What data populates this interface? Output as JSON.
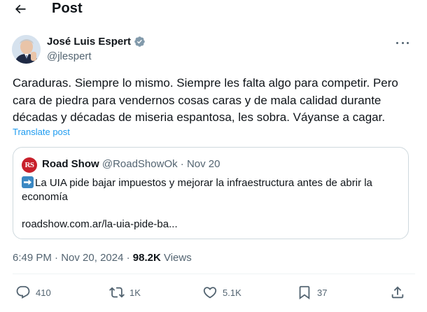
{
  "header": {
    "title": "Post"
  },
  "author": {
    "name": "José Luis Espert",
    "handle": "@jlespert"
  },
  "tweet": {
    "lines": [
      "Caraduras. Siempre lo mismo. Siempre les falta algo para competir. Pero",
      "cara de piedra para vendernos cosas caras y de mala calidad durante",
      "décadas y décadas de miseria espantosa, les sobra. Váyanse a cagar."
    ],
    "translate_label": "Translate post"
  },
  "quote": {
    "avatar_text": "RS",
    "name": "Road Show",
    "handle": "@RoadShowOk",
    "separator": " · ",
    "date": "Nov 20",
    "text_line1": "La UIA pide bajar impuestos y mejorar la infraestructura antes de abrir la",
    "text_line2": "economía",
    "link": "roadshow.com.ar/la-uia-pide-ba..."
  },
  "meta": {
    "time": "6:49 PM",
    "sep1": " · ",
    "date": "Nov 20, 2024",
    "sep2": " · ",
    "views_count": "98.2K",
    "views_label": " Views"
  },
  "actions": {
    "replies": "410",
    "reposts": "1K",
    "likes": "5.1K",
    "bookmarks": "37"
  },
  "colors": {
    "accent": "#1d9bf0",
    "text": "#0f1419",
    "secondary": "#536471",
    "border": "#cfd9de",
    "verified": "#829aab"
  }
}
